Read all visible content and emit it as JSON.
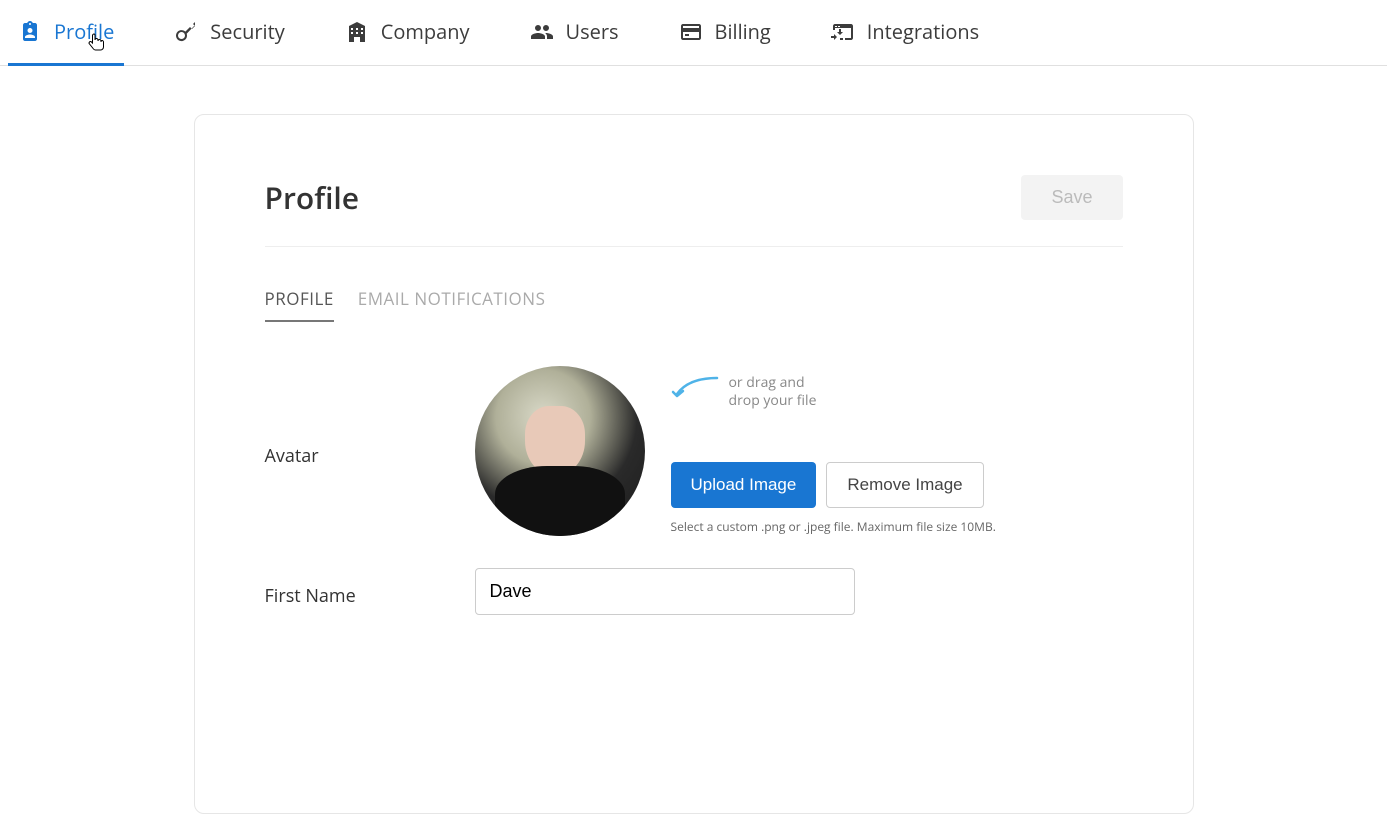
{
  "topTabs": {
    "profile": "Profile",
    "security": "Security",
    "company": "Company",
    "users": "Users",
    "billing": "Billing",
    "integrations": "Integrations"
  },
  "card": {
    "title": "Profile",
    "saveLabel": "Save"
  },
  "subTabs": {
    "profile": "PROFILE",
    "emailNotifications": "EMAIL NOTIFICATIONS"
  },
  "avatar": {
    "label": "Avatar",
    "dragHint1": "or drag and",
    "dragHint2": "drop your file",
    "uploadLabel": "Upload Image",
    "removeLabel": "Remove Image",
    "help": "Select a custom .png or .jpeg file. Maximum file size 10MB."
  },
  "firstName": {
    "label": "First Name",
    "value": "Dave"
  }
}
